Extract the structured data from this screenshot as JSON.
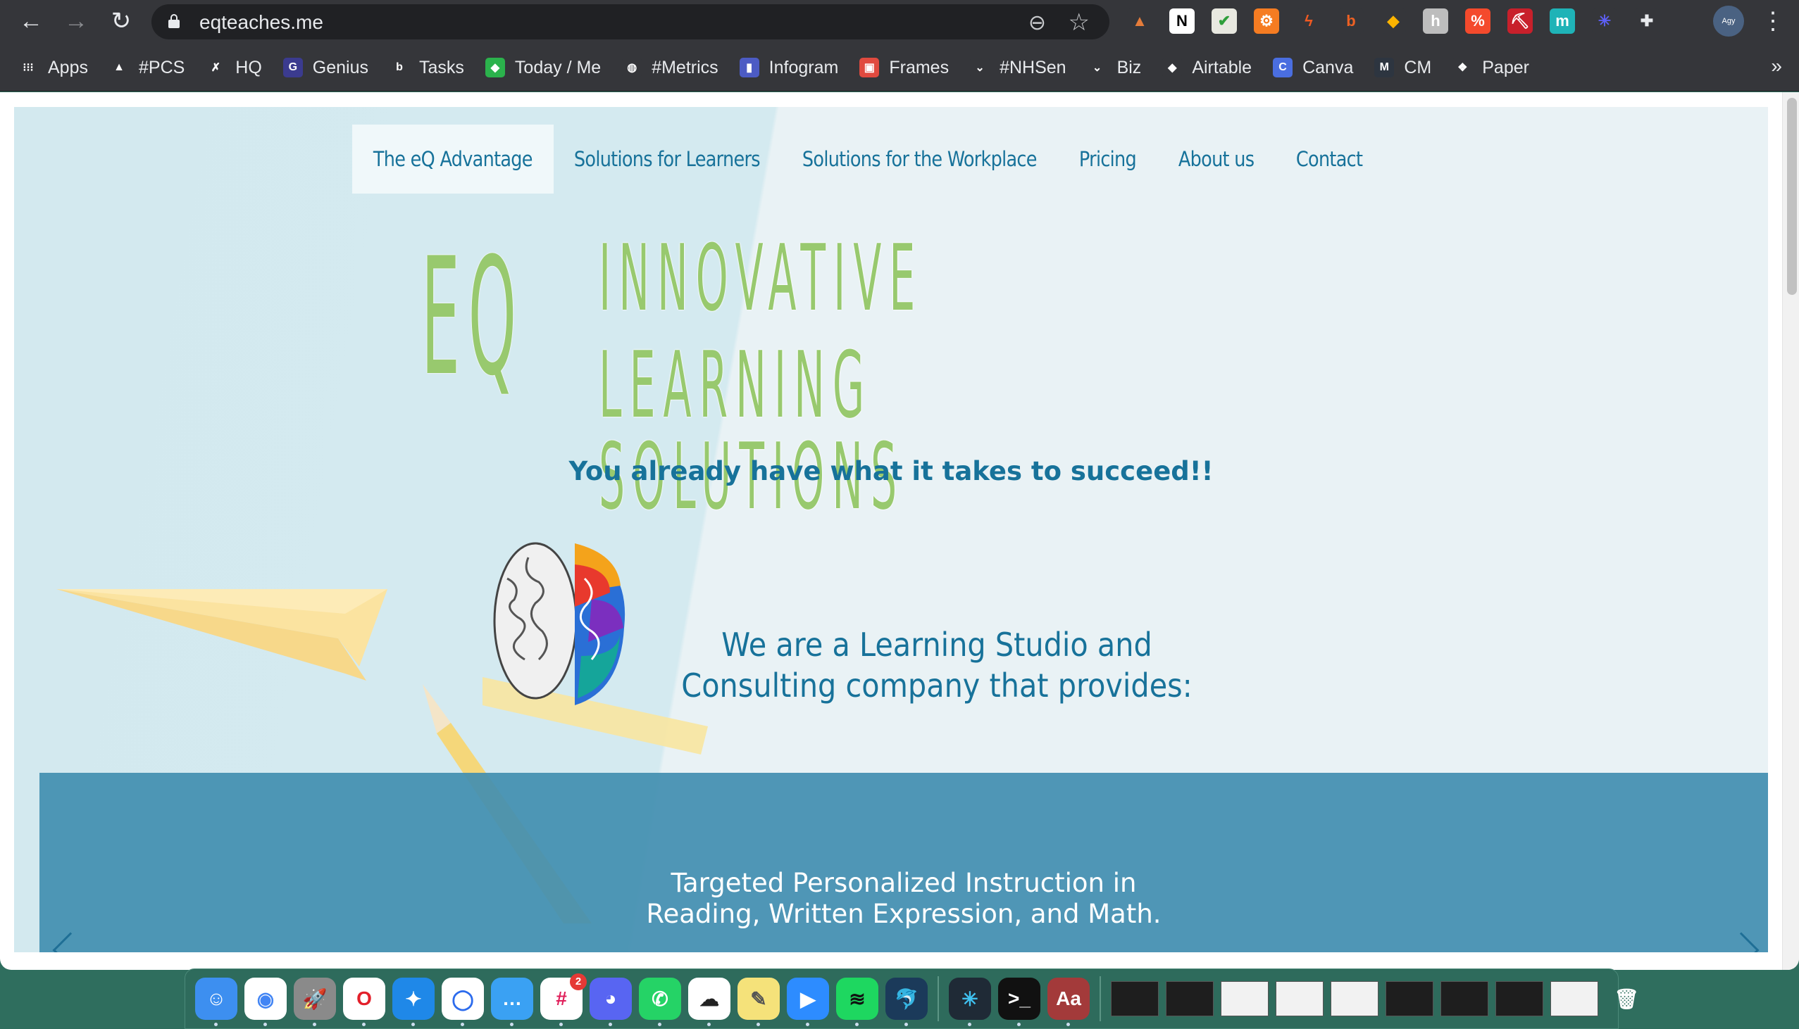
{
  "browser": {
    "url": "eqteaches.me",
    "nav": {
      "back": "←",
      "forward": "→",
      "reload": "↻"
    },
    "extensions": [
      {
        "name": "arc-ext",
        "glyph": "▲",
        "color": "#35363a",
        "fg": "#e57c3a"
      },
      {
        "name": "notion",
        "glyph": "N",
        "color": "#ffffff",
        "fg": "#000000"
      },
      {
        "name": "checkmark",
        "glyph": "✔",
        "color": "#e8e8e0",
        "fg": "#2e9e3a"
      },
      {
        "name": "hubspot",
        "glyph": "⚙",
        "color": "#f57c22",
        "fg": "#ffffff"
      },
      {
        "name": "bolt",
        "glyph": "ϟ",
        "color": "#35363a",
        "fg": "#f05a22"
      },
      {
        "name": "bitly",
        "glyph": "b",
        "color": "#35363a",
        "fg": "#ee6123"
      },
      {
        "name": "airtable",
        "glyph": "◆",
        "color": "#35363a",
        "fg": "#fcb400"
      },
      {
        "name": "hemingway",
        "glyph": "h",
        "color": "#bdbdbd",
        "fg": "#ffffff"
      },
      {
        "name": "code-ext",
        "glyph": "%",
        "color": "#f44a2c",
        "fg": "#ffffff"
      },
      {
        "name": "pick-ext",
        "glyph": "⛏",
        "color": "#c8202b",
        "fg": "#ffffff"
      },
      {
        "name": "m-ext",
        "glyph": "m",
        "color": "#1fb3b7",
        "fg": "#ffffff"
      },
      {
        "name": "asterisk-ext",
        "glyph": "✳",
        "color": "#35363a",
        "fg": "#5d5ff5"
      },
      {
        "name": "puzzle",
        "glyph": "✚",
        "color": "#35363a",
        "fg": "#e8eaed"
      }
    ],
    "profile_label": "Agy",
    "more": "⋮"
  },
  "bookmarks": [
    {
      "label": "Apps",
      "icon": "apps-grid-icon",
      "glyph": "⁝⁝⁝",
      "color": "#35363a"
    },
    {
      "label": "#PCS",
      "icon": "google-drive-icon",
      "glyph": "▲",
      "color": "#35363a"
    },
    {
      "label": "HQ",
      "icon": "hq-icon",
      "glyph": "✗",
      "color": "#35363a"
    },
    {
      "label": "Genius",
      "icon": "genius-icon",
      "glyph": "G",
      "color": "#3b3b8f"
    },
    {
      "label": "Tasks",
      "icon": "b-icon",
      "glyph": "b",
      "color": "#35363a"
    },
    {
      "label": "Today / Me",
      "icon": "feedly-icon",
      "glyph": "◆",
      "color": "#2bb24c"
    },
    {
      "label": "#Metrics",
      "icon": "globe-icon",
      "glyph": "◍",
      "color": "#35363a"
    },
    {
      "label": "Infogram",
      "icon": "infogram-icon",
      "glyph": "▮",
      "color": "#4c5bc4"
    },
    {
      "label": "Frames",
      "icon": "frames-icon",
      "glyph": "▣",
      "color": "#e04a3f"
    },
    {
      "label": "#NHSen",
      "icon": "chevrons-icon",
      "glyph": "⌄",
      "color": "#35363a"
    },
    {
      "label": "Biz",
      "icon": "chevrons-icon",
      "glyph": "⌄",
      "color": "#35363a"
    },
    {
      "label": "Airtable",
      "icon": "airtable-icon",
      "glyph": "◆",
      "color": "#35363a"
    },
    {
      "label": "Canva",
      "icon": "canva-icon",
      "glyph": "C",
      "color": "#4a6ee0"
    },
    {
      "label": "CM",
      "icon": "cm-icon",
      "glyph": "M",
      "color": "#2d3540"
    },
    {
      "label": "Paper",
      "icon": "dropbox-icon",
      "glyph": "❖",
      "color": "#35363a"
    }
  ],
  "bookmarks_more": "»",
  "site": {
    "nav": [
      {
        "label": "The eQ Advantage",
        "active": true
      },
      {
        "label": "Solutions for Learners",
        "active": false
      },
      {
        "label": "Solutions for the Workplace",
        "active": false
      },
      {
        "label": "Pricing",
        "active": false
      },
      {
        "label": "About us",
        "active": false
      },
      {
        "label": "Contact",
        "active": false
      }
    ],
    "logo": "EQ",
    "title_line1": "INNOVATIVE",
    "title_line2": "LEARNING SOLUTIONS",
    "tagline": "You already have what it takes to succeed!!",
    "intro_line1": "We are a Learning Studio and",
    "intro_line2": "Consulting company that provides:",
    "carousel": {
      "line1": "Targeted Personalized Instruction in",
      "line2": "Reading, Written Expression, and Math.",
      "prev": "previous-slide",
      "next": "next-slide"
    },
    "colors": {
      "accent_blue": "#17729a",
      "title_green": "#98c96e",
      "panel_blue": "#418eb0"
    }
  },
  "dock": {
    "apps": [
      {
        "name": "finder",
        "glyph": "☺",
        "bg": "#3d8ff0"
      },
      {
        "name": "chrome",
        "glyph": "◉",
        "bg": "#ffffff",
        "fg": "#4285f4"
      },
      {
        "name": "launchpad",
        "glyph": "🚀",
        "bg": "#8a8a8a"
      },
      {
        "name": "opera",
        "glyph": "O",
        "bg": "#ffffff",
        "fg": "#e3202b"
      },
      {
        "name": "safari",
        "glyph": "✦",
        "bg": "#1f88e8"
      },
      {
        "name": "signal",
        "glyph": "◯",
        "bg": "#ffffff",
        "fg": "#2c6bed"
      },
      {
        "name": "messages",
        "glyph": "…",
        "bg": "#3aa1f3"
      },
      {
        "name": "slack",
        "glyph": "#",
        "bg": "#ffffff",
        "fg": "#e01e5a",
        "badge": "2"
      },
      {
        "name": "discord",
        "glyph": "◕",
        "bg": "#5865f2"
      },
      {
        "name": "whatsapp",
        "glyph": "✆",
        "bg": "#25d366"
      },
      {
        "name": "cloud-app",
        "glyph": "☁",
        "bg": "#ffffff",
        "fg": "#222222"
      },
      {
        "name": "stickies",
        "glyph": "✎",
        "bg": "#f5e27a",
        "fg": "#555555"
      },
      {
        "name": "zoom",
        "glyph": "▶",
        "bg": "#2d8cff"
      },
      {
        "name": "spotify",
        "glyph": "≋",
        "bg": "#1ed760",
        "fg": "#111111"
      },
      {
        "name": "mysql-workbench",
        "glyph": "🐬",
        "bg": "#1b3a5a"
      }
    ],
    "apps2": [
      {
        "name": "vscode-like",
        "glyph": "✳",
        "bg": "#1f2a36",
        "fg": "#3fc1f0"
      },
      {
        "name": "terminal",
        "glyph": ">_",
        "bg": "#111111"
      },
      {
        "name": "dictionary",
        "glyph": "Aa",
        "bg": "#a33a3a"
      }
    ],
    "windows": 9,
    "trash": "🗑"
  }
}
